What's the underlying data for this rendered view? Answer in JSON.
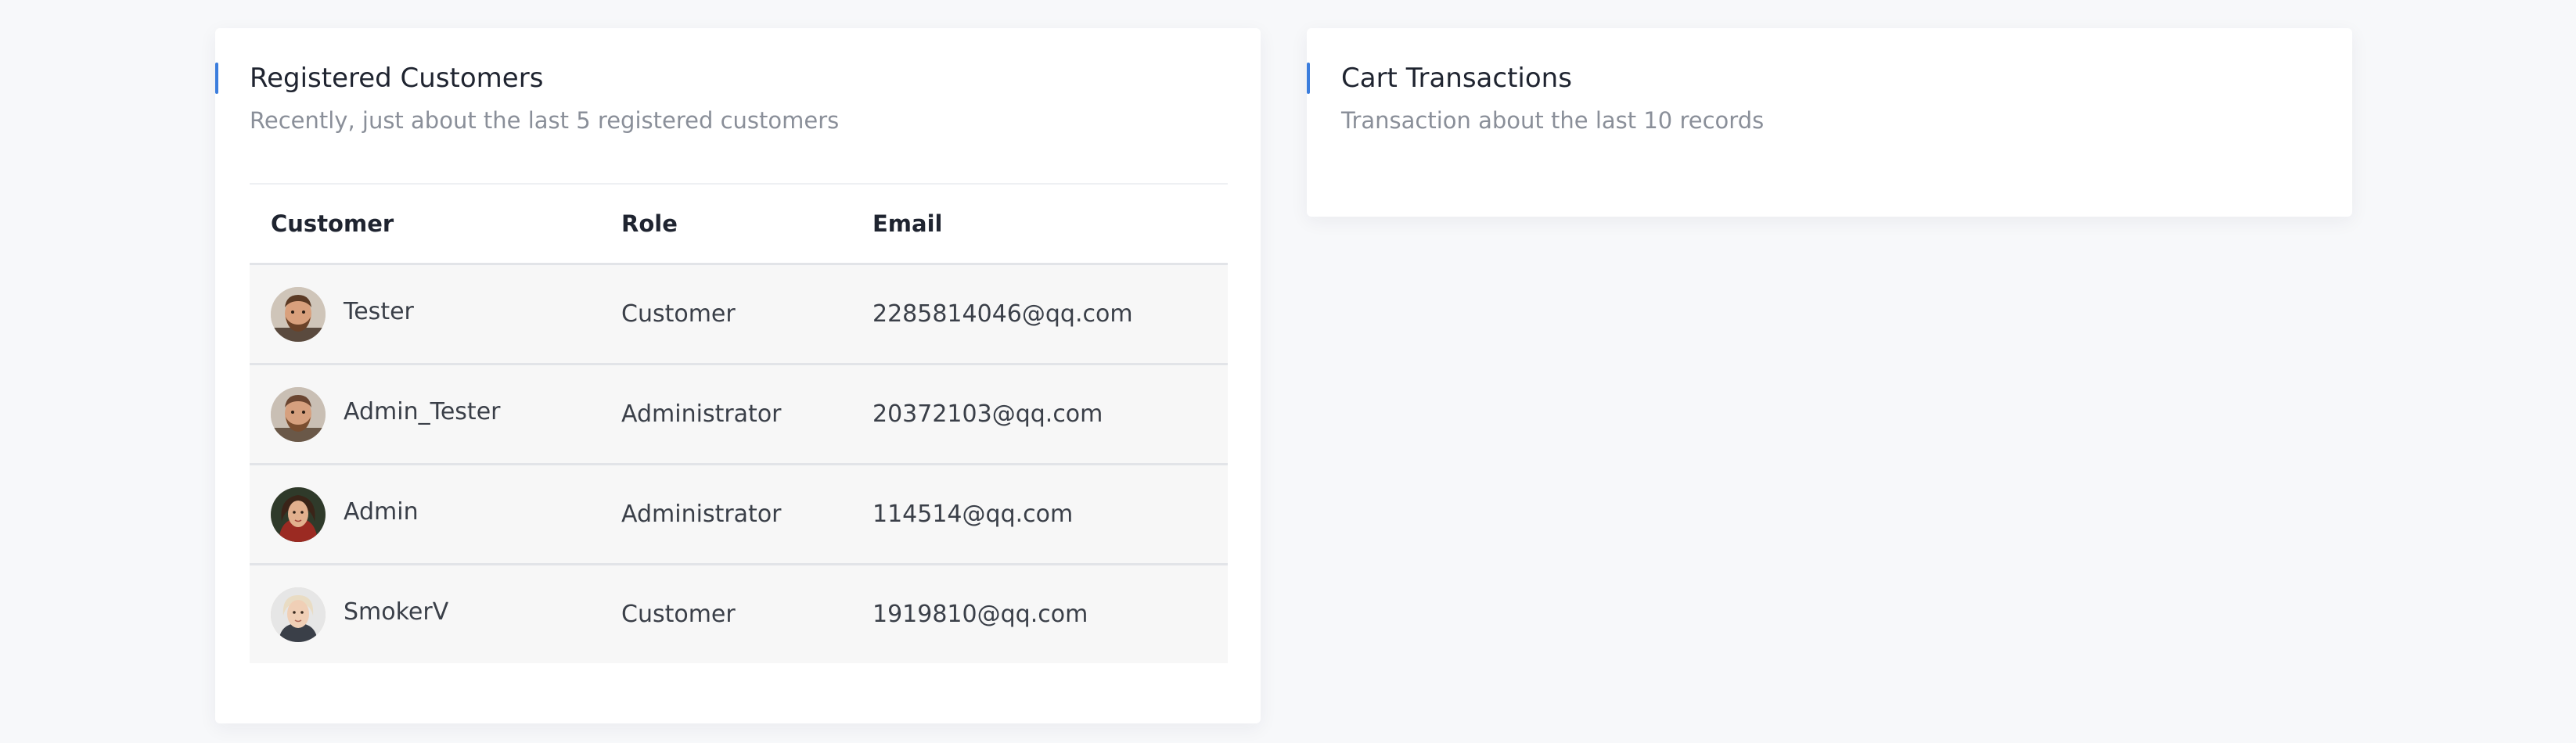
{
  "registered_customers": {
    "title": "Registered Customers",
    "subtitle": "Recently, just about the last 5 registered customers",
    "accent_color": "#3b7ddd",
    "columns": {
      "customer": "Customer",
      "role": "Role",
      "email": "Email"
    },
    "rows": [
      {
        "name": "Tester",
        "role": "Customer",
        "email": "2285814046@qq.com",
        "avatar": "man-beard-avatar"
      },
      {
        "name": "Admin_Tester",
        "role": "Administrator",
        "email": "20372103@qq.com",
        "avatar": "man-beard-avatar"
      },
      {
        "name": "Admin",
        "role": "Administrator",
        "email": "114514@qq.com",
        "avatar": "woman-avatar"
      },
      {
        "name": "SmokerV",
        "role": "Customer",
        "email": "1919810@qq.com",
        "avatar": "older-woman-avatar"
      }
    ]
  },
  "cart_transactions": {
    "title": "Cart Transactions",
    "subtitle": "Transaction about the last 10 records",
    "accent_color": "#3b7ddd"
  }
}
